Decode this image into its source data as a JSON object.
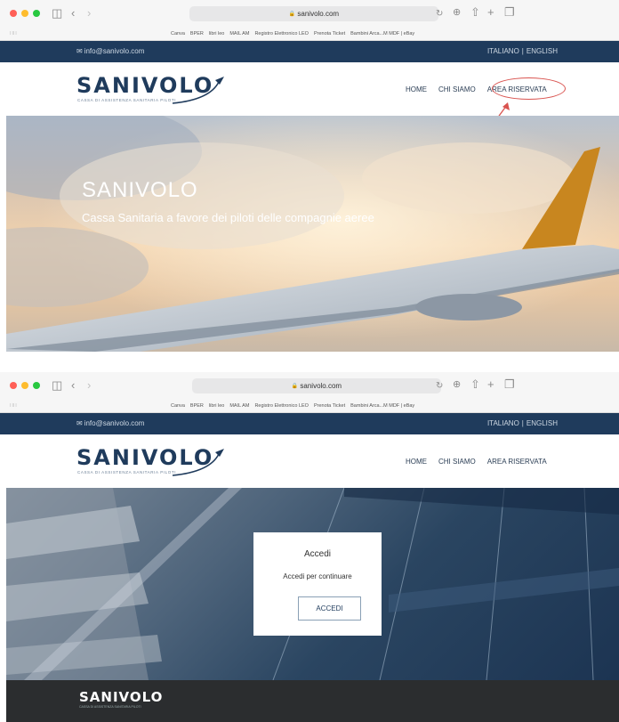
{
  "browser": {
    "url": "sanivolo.com",
    "bookmarks": [
      "Canva",
      "BPER",
      "libri leo",
      "MAIL AM",
      "Registro Elettronico LEO",
      "Prenota Ticket",
      "Bambini Arca...M MDF | eBay"
    ]
  },
  "site": {
    "email": "info@sanivolo.com",
    "languages": [
      "ITALIANO",
      "ENGLISH"
    ],
    "lang_separator": "|",
    "logo_word": "SANIVOLO",
    "logo_tagline": "CASSA DI ASSISTENZA SANITARIA PILOTI",
    "nav": [
      "HOME",
      "CHI SIAMO",
      "AREA RISERVATA"
    ]
  },
  "hero": {
    "title": "SANIVOLO",
    "subtitle": "Cassa Sanitaria a favore dei piloti delle compagnie aeree"
  },
  "login": {
    "title": "Accedi",
    "message": "Accedi per continuare",
    "button": "ACCEDI"
  },
  "colors": {
    "brand": "#1f3b5c",
    "annotation": "#d9534f",
    "footer": "#2b2d2f"
  },
  "icons": [
    "sidebar-toggle-icon",
    "back-icon",
    "forward-icon",
    "lock-icon",
    "reload-icon",
    "download-icon",
    "share-icon",
    "new-tab-icon",
    "tab-overview-icon",
    "grid-icon",
    "mail-icon",
    "plane-swoosh-icon",
    "annotation-arrow-icon"
  ]
}
